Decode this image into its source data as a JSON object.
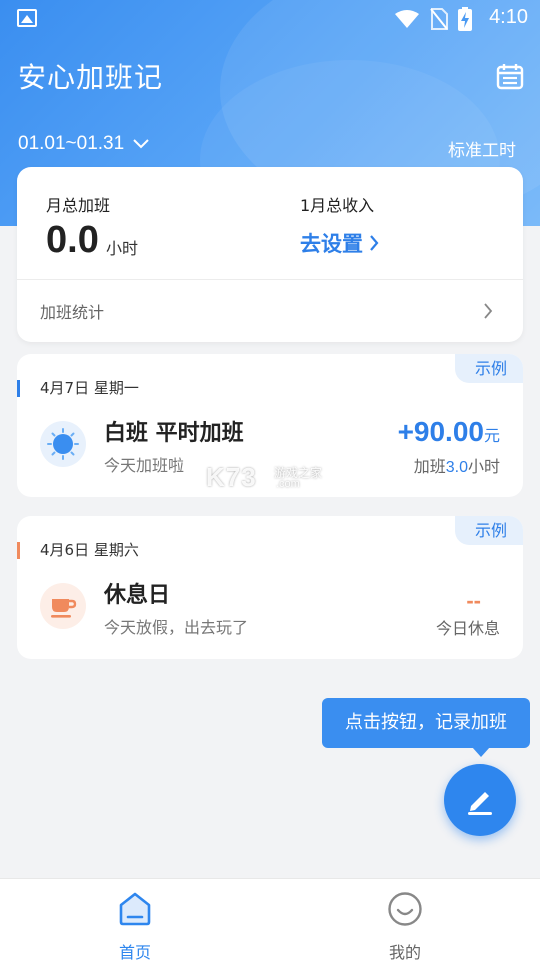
{
  "status_bar": {
    "time": "4:10"
  },
  "header": {
    "app_title": "安心加班记",
    "date_range": "01.01~01.31",
    "standard_hours": "标准工时"
  },
  "summary": {
    "overtime_label": "月总加班",
    "overtime_value": "0.0",
    "overtime_unit": "小时",
    "income_label": "1月总收入",
    "income_action": "去设置",
    "stats_label": "加班统计"
  },
  "records": [
    {
      "tag": "示例",
      "date": "4月7日 星期一",
      "title": "白班 平时加班",
      "subtitle": "今天加班啦",
      "amount": "+90.00",
      "amount_unit": "元",
      "detail_prefix": "加班",
      "detail_hours": "3.0",
      "detail_suffix": "小时",
      "accent": "#2e7fe8"
    },
    {
      "tag": "示例",
      "date": "4月6日 星期六",
      "title": "休息日",
      "subtitle": "今天放假，出去玩了",
      "amount": "--",
      "detail": "今日休息",
      "accent": "#f08a5d"
    }
  ],
  "watermark": {
    "brand": "K73",
    "cn": "游戏之家",
    "domain": ".com"
  },
  "tooltip": "点击按钮，记录加班",
  "tabbar": {
    "tabs": [
      {
        "label": "首页",
        "active": true,
        "icon": "home-icon"
      },
      {
        "label": "我的",
        "active": false,
        "icon": "profile-icon"
      }
    ]
  },
  "colors": {
    "primary": "#2e86ee",
    "rest": "#f08a5d",
    "background": "#f2f3f5"
  }
}
